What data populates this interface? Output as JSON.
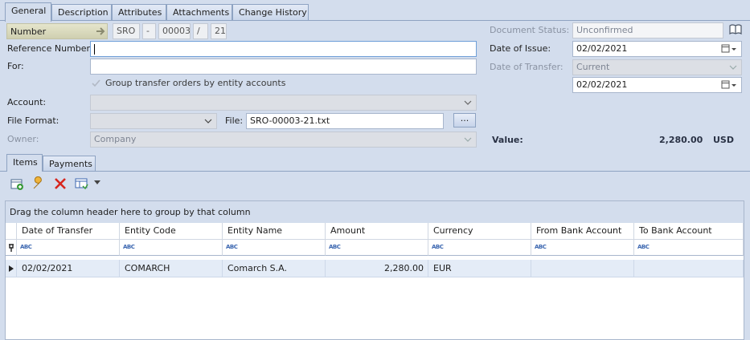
{
  "tabs": [
    "General",
    "Description",
    "Attributes",
    "Attachments",
    "Change History"
  ],
  "number": {
    "label": "Number",
    "prefix": "SRO",
    "sep1": "-",
    "counter": "00003",
    "sep2": "/",
    "year": "21"
  },
  "reference_number": {
    "label": "Reference Number:",
    "value": ""
  },
  "for_field": {
    "label": "For:",
    "value": ""
  },
  "group_checkbox": {
    "label": "Group transfer orders by entity accounts",
    "checked": true
  },
  "account": {
    "label": "Account:",
    "value": ""
  },
  "file_format": {
    "label": "File Format:",
    "value": ""
  },
  "file": {
    "label": "File:",
    "value": "SRO-00003-21.txt",
    "browse_label": "..."
  },
  "owner": {
    "label": "Owner:",
    "value": "Company"
  },
  "document_status": {
    "label": "Document Status:",
    "value": "Unconfirmed"
  },
  "date_of_issue": {
    "label": "Date of Issue:",
    "value": "02/02/2021"
  },
  "date_of_transfer": {
    "label": "Date of Transfer:",
    "mode": "Current",
    "value": "02/02/2021"
  },
  "value_summary": {
    "label": "Value:",
    "amount": "2,280.00",
    "currency": "USD"
  },
  "sub_tabs": [
    "Items",
    "Payments"
  ],
  "grid": {
    "group_hint": "Drag the column header here to group by that column",
    "columns": [
      "Date of Transfer",
      "Entity Code",
      "Entity Name",
      "Amount",
      "Currency",
      "From Bank Account",
      "To Bank Account"
    ],
    "filter_glyph": "ABC",
    "rows": [
      [
        "02/02/2021",
        "COMARCH",
        "Comarch S.A.",
        "2,280.00",
        "EUR",
        "",
        ""
      ]
    ]
  }
}
